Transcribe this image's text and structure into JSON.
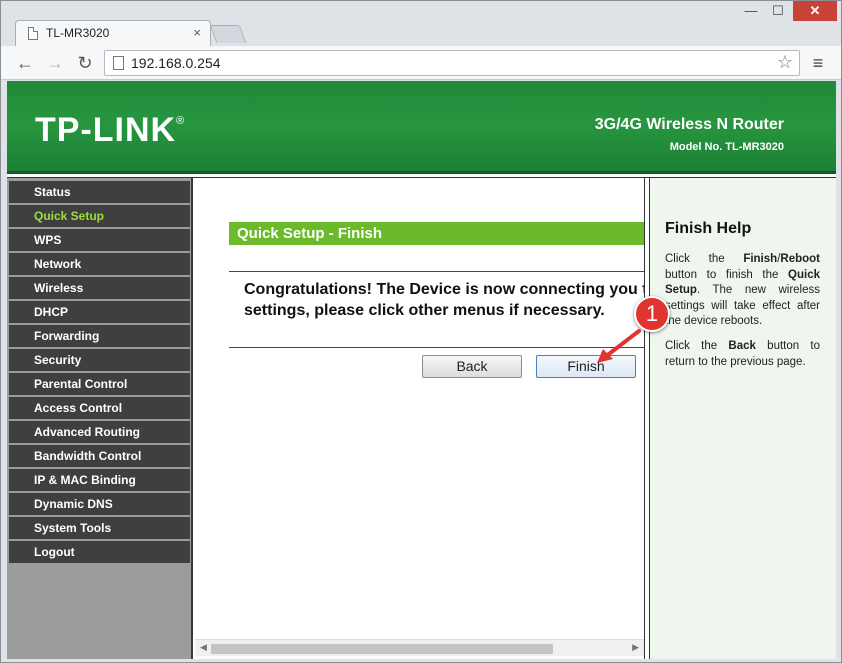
{
  "browser": {
    "tab_title": "TL-MR3020",
    "url": "192.168.0.254",
    "close_glyph": "×",
    "window_controls": {
      "minimize": "—",
      "maximize": "☐",
      "close": "✕"
    },
    "nav": {
      "back": "←",
      "forward": "→",
      "reload": "↻",
      "star": "☆",
      "menu": "≡"
    }
  },
  "banner": {
    "logo": "TP-LINK",
    "logo_mark": "®",
    "product": "3G/4G Wireless N Router",
    "model": "Model No. TL-MR3020"
  },
  "sidebar": {
    "items": [
      {
        "label": "Status"
      },
      {
        "label": "Quick Setup",
        "active": true
      },
      {
        "label": "WPS"
      },
      {
        "label": "Network"
      },
      {
        "label": "Wireless"
      },
      {
        "label": "DHCP"
      },
      {
        "label": "Forwarding"
      },
      {
        "label": "Security"
      },
      {
        "label": "Parental Control"
      },
      {
        "label": "Access Control"
      },
      {
        "label": "Advanced Routing"
      },
      {
        "label": "Bandwidth Control"
      },
      {
        "label": "IP & MAC Binding"
      },
      {
        "label": "Dynamic DNS"
      },
      {
        "label": "System Tools"
      },
      {
        "label": "Logout"
      }
    ]
  },
  "main": {
    "section_title": "Quick Setup - Finish",
    "message_line1": "Congratulations! The Device is now connecting you t",
    "message_line2": "settings, please click other menus if necessary.",
    "back_label": "Back",
    "finish_label": "Finish"
  },
  "help": {
    "title": "Finish Help",
    "p1_a": "Click the ",
    "p1_b": "Finish",
    "p1_c": "/",
    "p1_d": "Reboot",
    "p1_e": " button to finish the ",
    "p1_f": "Quick Setup",
    "p1_g": ". The new wireless settings will take effect after the device reboots.",
    "p2_a": "Click the ",
    "p2_b": "Back",
    "p2_c": " button to return to the previous page."
  },
  "annotation": {
    "step_number": "1"
  },
  "colors": {
    "banner_green": "#27963f",
    "section_green": "#6aba2a",
    "active_menu": "#9be03a",
    "menu_bg": "#3f3f3f",
    "callout_red": "#e0352e"
  }
}
